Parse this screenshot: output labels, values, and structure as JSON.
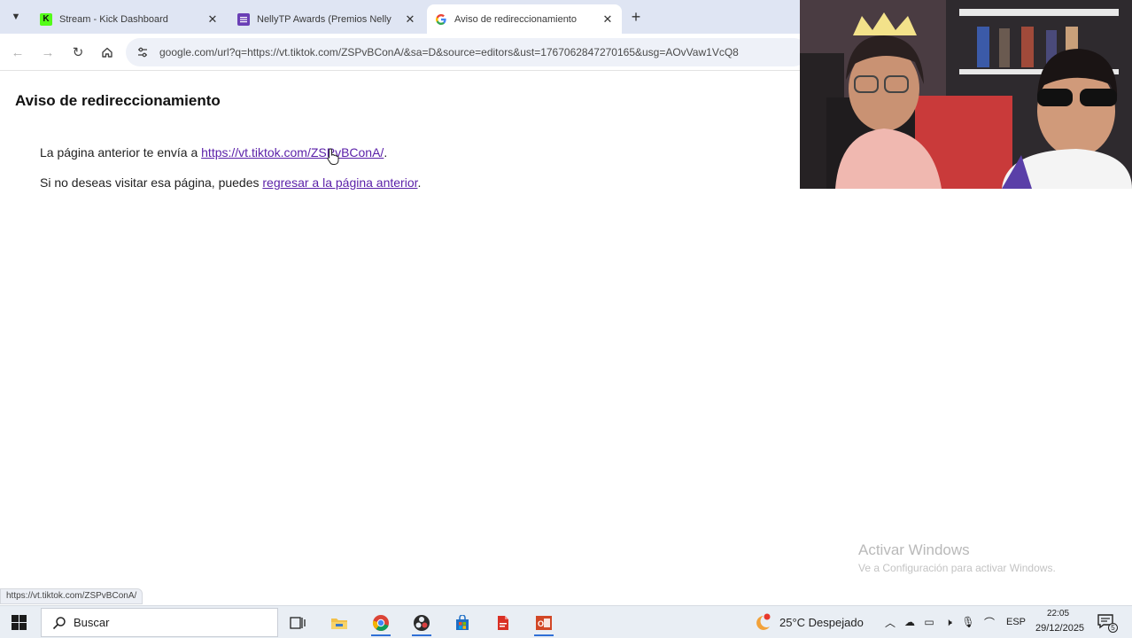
{
  "browser": {
    "tabs": [
      {
        "title": "Stream - Kick Dashboard",
        "active": false,
        "favicon": "kick-icon"
      },
      {
        "title": "NellyTP Awards (Premios Nelly",
        "active": false,
        "favicon": "forms-icon"
      },
      {
        "title": "Aviso de redireccionamiento",
        "active": true,
        "favicon": "google-icon"
      }
    ],
    "address": "google.com/url?q=https://vt.tiktok.com/ZSPvBConA/&sa=D&source=editors&ust=1767062847270165&usg=AOvVaw1VcQ8"
  },
  "page": {
    "heading": "Aviso de redireccionamiento",
    "line1_prefix": "La página anterior te envía a ",
    "line1_link": "https://vt.tiktok.com/ZSPvBConA/",
    "line1_suffix": ".",
    "line2_prefix": "Si no deseas visitar esa página, puedes ",
    "line2_link": "regresar a la página anterior",
    "line2_suffix": "."
  },
  "status_bar": "https://vt.tiktok.com/ZSPvBConA/",
  "watermark": {
    "title": "Activar Windows",
    "subtitle": "Ve a Configuración para activar Windows."
  },
  "taskbar": {
    "search_placeholder": "Buscar",
    "apps": [
      "task-view-icon",
      "file-explorer-icon",
      "chrome-icon",
      "obs-icon",
      "store-icon",
      "pdf-icon",
      "office-icon"
    ],
    "weather": "25°C  Despejado",
    "language": "ESP",
    "time": "22:05",
    "date": "29/12/2025",
    "notifications": "5"
  },
  "colors": {
    "link_visited": "#5a1fa8",
    "tab_strip": "#dfe5f3",
    "taskbar": "#e9eef4"
  }
}
